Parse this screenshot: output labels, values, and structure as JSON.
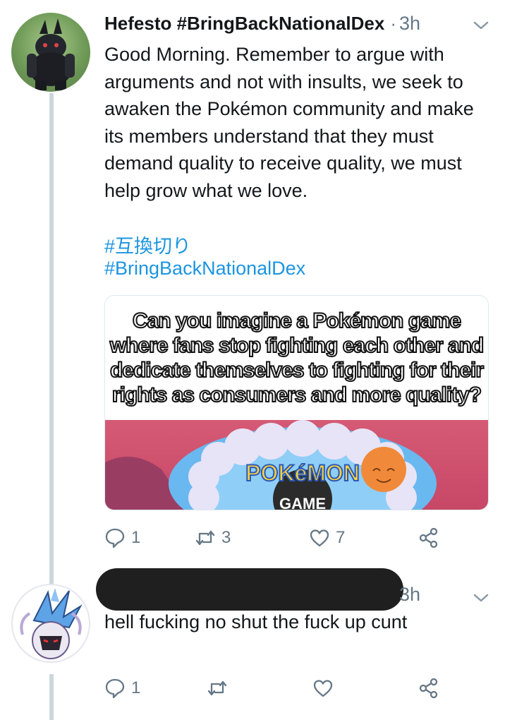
{
  "tweet1": {
    "name": "Hefesto #BringBackNationalDex",
    "separator": "·",
    "time": "3h",
    "text": "Good Morning.  Remember to argue with arguments and not with insults, we seek to awaken the Pokémon community and make its members understand that they must demand quality to receive quality, we must help grow what we love.",
    "hashtags": [
      "#互換切り",
      "#BringBackNationalDex"
    ],
    "media": {
      "caption": "Can you imagine a Pokémon game where fans stop fighting each other and dedicate themselves to fighting for their rights as consumers and more quality?",
      "logo_text": "POKéMON",
      "logo_sub": "GAME"
    },
    "actions": {
      "reply_count": "1",
      "retweet_count": "3",
      "like_count": "7"
    }
  },
  "tweet2": {
    "separator": "·",
    "time": "3h",
    "text": "hell fucking no shut the fuck up cunt",
    "actions": {
      "reply_count": "1",
      "retweet_count": "",
      "like_count": ""
    }
  },
  "colors": {
    "accent": "#1b95e0",
    "muted": "#657786",
    "thread_line": "#ccd6dd"
  }
}
